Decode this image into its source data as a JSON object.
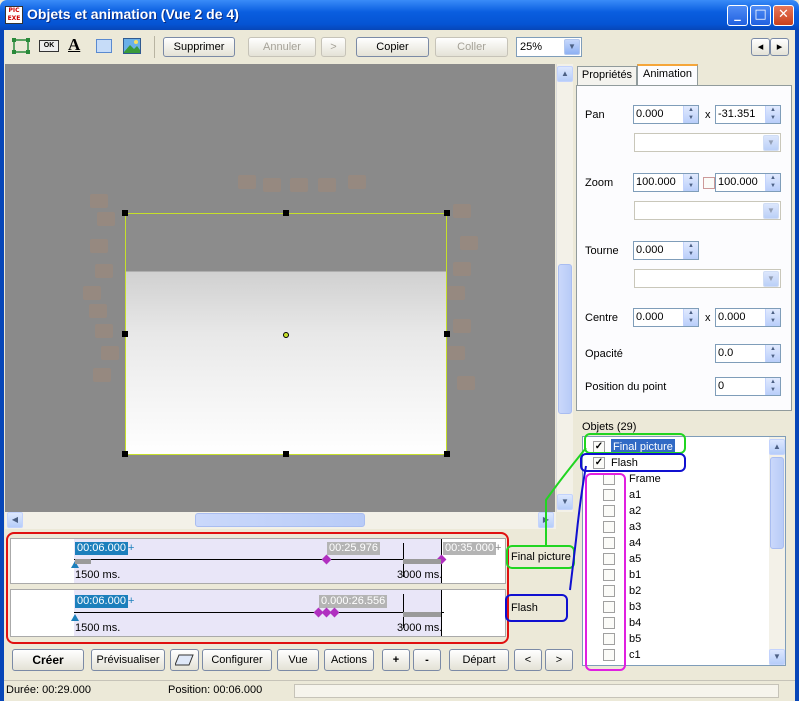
{
  "window": {
    "title": "Objets et animation  (Vue 2 de 4)",
    "app_icon_text": "PIC EXE",
    "minimize": "_",
    "maximize": "□",
    "close": "✕"
  },
  "toolbar": {
    "delete_label": "Supprimer",
    "undo_label": "Annuler",
    "redo_label": ">",
    "copy_label": "Copier",
    "paste_label": "Coller",
    "zoom_value": "25%",
    "ok_icon_text": "OK",
    "text_icon_text": "A",
    "nav_prev": "◂",
    "nav_next": "▸"
  },
  "tabs": {
    "properties": "Propriétés",
    "animation": "Animation"
  },
  "animation": {
    "pan_label": "Pan",
    "pan_x": "0.000",
    "pan_y": "-31.351",
    "x_sep": "x",
    "zoom_label": "Zoom",
    "zoom_x": "100.000",
    "zoom_y": "100.000",
    "rotate_label": "Tourne",
    "rotate_value": "0.000",
    "center_label": "Centre",
    "center_x": "0.000",
    "center_y": "0.000",
    "opacity_label": "Opacité",
    "opacity_value": "0.0",
    "point_label": "Position du point",
    "point_value": "0"
  },
  "objects": {
    "header": "Objets (29)",
    "items": [
      {
        "label": "Final picture",
        "checked": true
      },
      {
        "label": "Flash",
        "checked": true
      },
      {
        "label": "Frame",
        "checked": false
      },
      {
        "label": "a1",
        "checked": false
      },
      {
        "label": "a2",
        "checked": false
      },
      {
        "label": "a3",
        "checked": false
      },
      {
        "label": "a4",
        "checked": false
      },
      {
        "label": "a5",
        "checked": false
      },
      {
        "label": "b1",
        "checked": false
      },
      {
        "label": "b2",
        "checked": false
      },
      {
        "label": "b3",
        "checked": false
      },
      {
        "label": "b4",
        "checked": false
      },
      {
        "label": "b5",
        "checked": false
      },
      {
        "label": "c1",
        "checked": false
      }
    ]
  },
  "timeline": {
    "track1": {
      "name": "Final picture",
      "key1": "00:06.000",
      "key2": "00:25.976",
      "key3": "00:35.000",
      "plus": "+",
      "mark1": "1500 ms.",
      "mark2": "3000 ms."
    },
    "track2": {
      "name": "Flash",
      "key1": "00:06.000",
      "key2": "0.000:26.556",
      "plus": "+",
      "mark1": "1500 ms.",
      "mark2": "3000 ms."
    }
  },
  "bottom": {
    "create": "Créer",
    "preview": "Prévisualiser",
    "configure": "Configurer",
    "view": "Vue",
    "actions": "Actions",
    "plus": "+",
    "minus": "-",
    "start": "Départ",
    "prev": "<",
    "next": ">"
  },
  "status": {
    "duration": "Durée:  00:29.000",
    "position": "Position:  00:06.000"
  },
  "colors": {
    "annotation_green": "#21d521",
    "annotation_blue": "#1010d0",
    "annotation_magenta": "#e020e0",
    "annotation_red": "#e01010",
    "key_blue": "#1c7fbc"
  }
}
